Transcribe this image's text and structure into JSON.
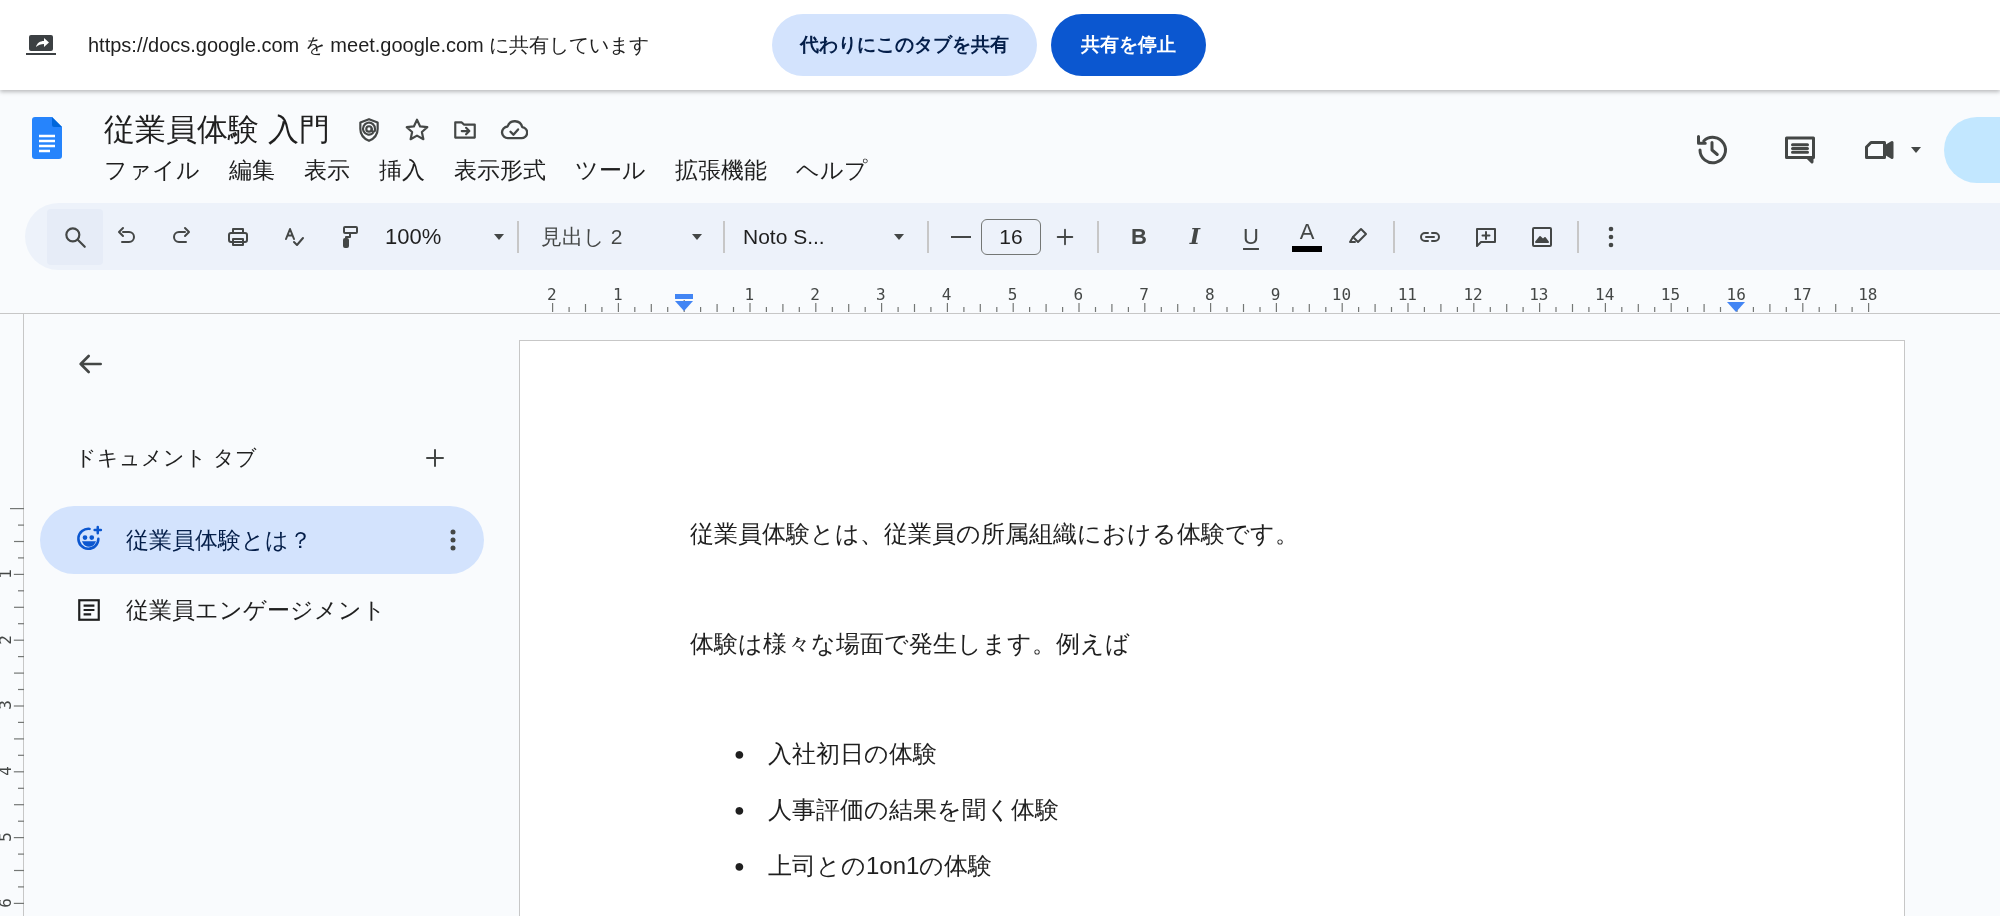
{
  "share_bar": {
    "message": "https://docs.google.com を meet.google.com に共有しています",
    "share_this_tab": "代わりにこのタブを共有",
    "stop_sharing": "共有を停止"
  },
  "document": {
    "title": "従業員体験 入門",
    "starred": false
  },
  "menu": [
    "ファイル",
    "編集",
    "表示",
    "挿入",
    "表示形式",
    "ツール",
    "拡張機能",
    "ヘルプ"
  ],
  "toolbar": {
    "zoom": "100%",
    "paragraph_style": "見出し 2",
    "font": "Noto S...",
    "font_size": "16",
    "format_buttons": [
      "B",
      "I",
      "U",
      "A"
    ]
  },
  "ruler": {
    "left_labels": [
      "2",
      "1"
    ],
    "right_labels": [
      "1",
      "2",
      "3",
      "4",
      "5",
      "6",
      "7",
      "8",
      "9",
      "10",
      "11",
      "12",
      "13",
      "14",
      "15",
      "16",
      "17",
      "18"
    ],
    "vertical_labels": [
      "1",
      "2",
      "3",
      "4",
      "5",
      "6"
    ]
  },
  "sidebar": {
    "heading": "ドキュメント タブ",
    "tabs": [
      {
        "label": "従業員体験とは？",
        "kind": "smiley",
        "selected": true
      },
      {
        "label": "従業員エンゲージメント",
        "kind": "document",
        "selected": false
      }
    ]
  },
  "body": {
    "paragraphs": [
      "従業員体験とは、従業員の所属組織における体験です。",
      "体験は様々な場面で発生します。例えば"
    ],
    "bullets": [
      {
        "marker": "●",
        "text": "入社初日の体験"
      },
      {
        "marker": "●",
        "text": "人事評価の結果を聞く体験"
      },
      {
        "marker": "●",
        "text": "上司との1on1の体験"
      }
    ]
  }
}
